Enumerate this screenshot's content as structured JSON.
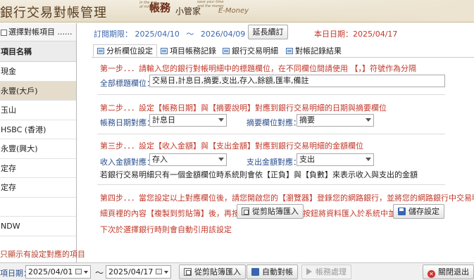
{
  "header": {
    "title": "銀行交易對帳管理",
    "logo_sub": "in the pet\nof minutes",
    "logo_main": "帳務",
    "logo_main2": "小管家",
    "logo_top": "save your time\nand the money",
    "logo_en": "E-Money"
  },
  "sidebar": {
    "select_label": "選擇對帳項目 ......",
    "list_header": "項目名稱",
    "items": [
      {
        "label": "現金",
        "selected": false
      },
      {
        "label": "永豐(大戶)",
        "selected": true
      },
      {
        "label": "玉山",
        "selected": false
      },
      {
        "label": "HSBC (香港)",
        "selected": false
      },
      {
        "label": "永豐(興大)",
        "selected": false
      },
      {
        "label": "定存",
        "selected": false
      },
      {
        "label": "定存",
        "selected": false
      },
      {
        "label": "",
        "selected": false
      },
      {
        "label": "NDW",
        "selected": false
      }
    ],
    "footnote": "只顯示有設定對應的項目"
  },
  "period": {
    "label": "訂閱期限：",
    "start": "2025/04/10",
    "tilde": "〜",
    "end": "2026/04/09",
    "extend_button": "延長續訂",
    "today_label": "本日日期：",
    "today": "2025/04/17"
  },
  "tabs": [
    {
      "label": "分析欄位設定",
      "active": true
    },
    {
      "label": "項目帳務記錄",
      "active": false
    },
    {
      "label": "銀行交易明細",
      "active": false
    },
    {
      "label": "對帳記錄結果",
      "active": false
    }
  ],
  "step1": {
    "title": "第一步．．．請輸入您的銀行對帳明細中的標題欄位，在不同欄位間請使用 【，】符號作為分隔",
    "all_fields_label": "全部標題欄位：",
    "all_fields_value": "交易日,計息日,摘要,支出,存入,餘額,匯率,備註"
  },
  "step2": {
    "title": "第二步．．．設定【帳務日期】與【摘要說明】對應到銀行交易明細的日期與摘要欄位",
    "date_label": "帳務日期對應：",
    "date_value": "計息日",
    "summary_label": "摘要欄位對應：",
    "summary_value": "摘要"
  },
  "step3": {
    "title": "第三步．．．設定【收入金額】與【支出金額】對應到銀行交易明細的金額欄位",
    "income_label": "收入金額對應：",
    "income_value": "存入",
    "expense_label": "支出金額對應：",
    "expense_value": "支出",
    "note": "若銀行交易明細只有一個金額欄位時系統則會依【正負】與【負數】來表示收入與支出的金額"
  },
  "step4": {
    "line1": "第四步．．．當您設定以上對應欄位後，請您開啟您的【瀏覽器】登錄您的網路銀行，並將您的網路銀行中交易明",
    "line2a": "細頁裡的內容【複製到剪貼簿】後，再按下",
    "paste_button": "從剪貼簿匯入",
    "line2b": "按鈕將資料匯入於系統中並",
    "save_button": "儲存設定",
    "line3": "下次於選擇銀行時則會自動引用該設定"
  },
  "bottom": {
    "date_label": "項日期：",
    "start_date": "2025/04/01",
    "tilde": "〜",
    "end_date": "2025/04/17",
    "import_button": "從剪貼簿匯入",
    "auto_button": "自動對帳",
    "process_button": "帳務處理",
    "close_button": "關閉退出"
  },
  "colors": {
    "step_red": "#c0392b",
    "label_blue": "#2b4f8e",
    "period_blue": "#3c67b0",
    "selected_bg": "#e6dccb"
  }
}
